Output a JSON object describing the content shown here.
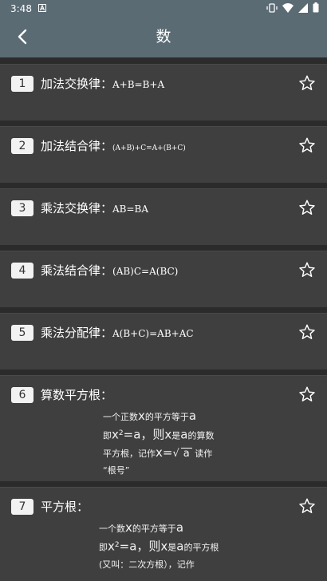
{
  "status": {
    "time": "3:48"
  },
  "header": {
    "title": "数"
  },
  "cards": [
    {
      "num": "1",
      "title": "加法交换律：",
      "formula": "A+B=B+A"
    },
    {
      "num": "2",
      "title": "加法结合律：",
      "formula": "(A+B)+C=A+(B+C)"
    },
    {
      "num": "3",
      "title": "乘法交换律：",
      "formula": "AB=BA"
    },
    {
      "num": "4",
      "title": "乘法结合律：",
      "formula": "(AB)C=A(BC)"
    },
    {
      "num": "5",
      "title": "乘法分配律：",
      "formula": "A(B+C)=AB+AC"
    },
    {
      "num": "6",
      "title": "算数平方根：",
      "desc": {
        "l1a": "一个正数",
        "x": "x",
        "l1b": "的平方等于",
        "a": "a",
        "l2a": "即",
        "l2x": "x",
        "sup": "2",
        "l2eq": "=a，则",
        "l2x2": "x",
        "l2b": "是",
        "l2a2": "a",
        "l2c": "的算数",
        "l3a": "平方根，记作",
        "l3x": "x=",
        "l3sq": "a",
        "l3b": "读作",
        "l4": "“根号”"
      }
    },
    {
      "num": "7",
      "title": "平方根：",
      "desc": {
        "l1a": "一个数",
        "x": "x",
        "l1b": "的平方等于",
        "a": "a",
        "l2a": "即",
        "l2x": "x",
        "sup": "2",
        "l2eq": "=a，则",
        "l2x2": "x",
        "l2b": "是",
        "l2a2": "a",
        "l2c": "的平方根",
        "l3": "(又叫：二次方根），记作"
      }
    }
  ]
}
